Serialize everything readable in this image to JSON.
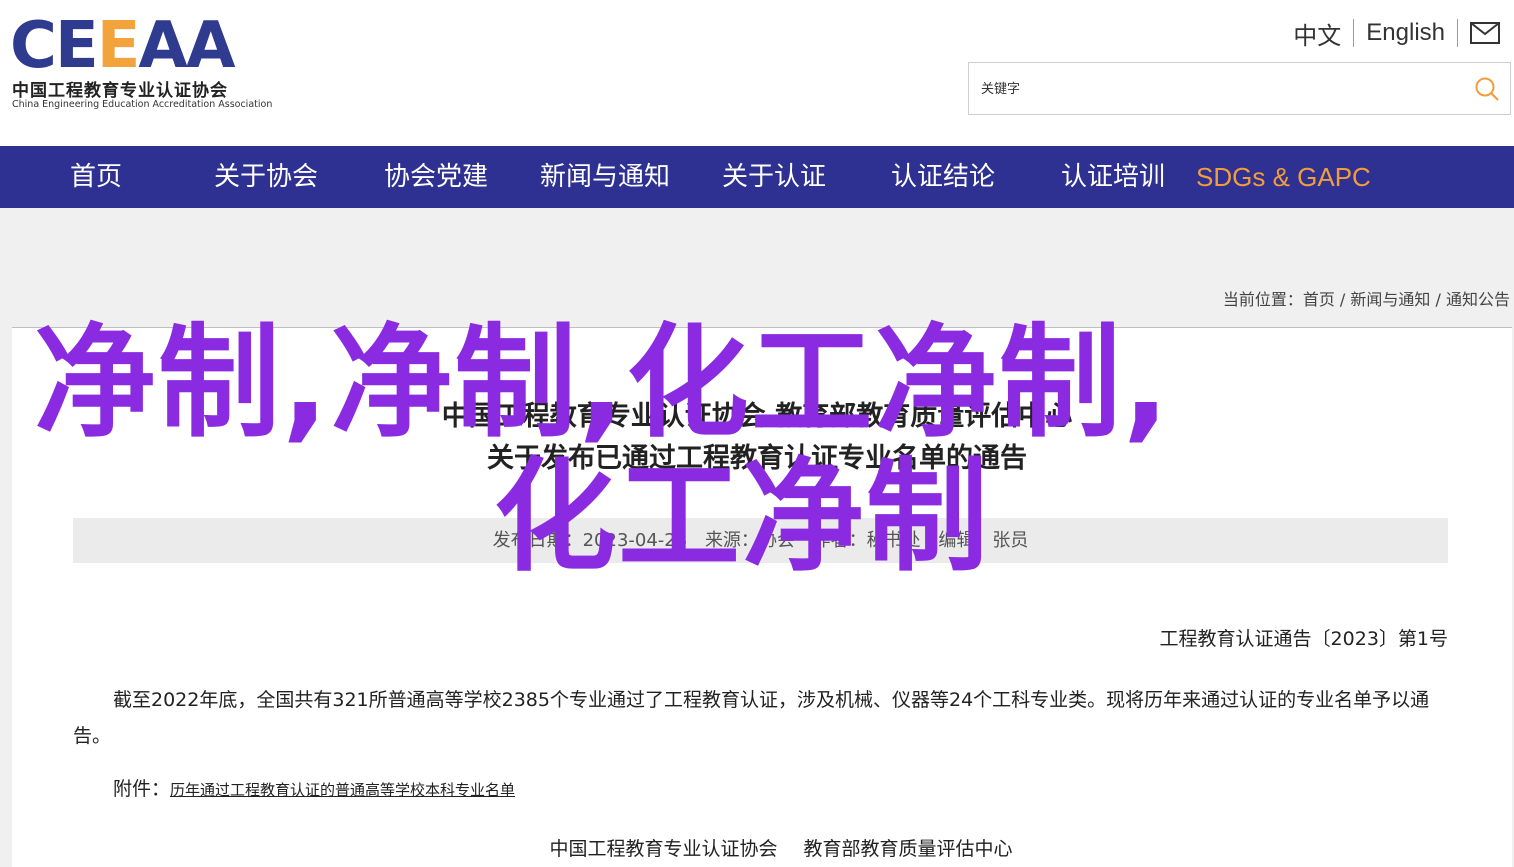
{
  "header": {
    "logo_mark": "CE",
    "logo_mark_mid": "E",
    "logo_mark_end": "AA",
    "logo_cn": "中国工程教育专业认证协会",
    "logo_en": "China Engineering Education Accreditation Association",
    "lang_cn": "中文",
    "lang_en": "English",
    "mail_icon": "mail-icon",
    "search_placeholder": "关键字",
    "search_icon": "search-icon"
  },
  "nav": {
    "items": [
      {
        "label": "首页"
      },
      {
        "label": "关于协会"
      },
      {
        "label": "协会党建"
      },
      {
        "label": "新闻与通知"
      },
      {
        "label": "关于认证"
      },
      {
        "label": "认证结论"
      },
      {
        "label": "认证培训"
      },
      {
        "label": "SDGs & GAPC"
      }
    ],
    "bg_color": "#2e3192",
    "accent_color": "#f39c3c"
  },
  "breadcrumb": {
    "prefix": "当前位置：",
    "items": [
      "首页",
      "新闻与通知",
      "通知公告"
    ],
    "sep": " / "
  },
  "article": {
    "title_line1": "中国工程教育专业认证协会 教育部教育质量评估中心",
    "title_line2": "关于发布已通过工程教育认证专业名单的通告",
    "meta_date": "发布日期：2023-04-28",
    "meta_source": "来源：协会",
    "meta_author": "作者：秘书处",
    "meta_editor": "编辑：张员",
    "doc_no": "工程教育认证通告〔2023〕第1号",
    "paragraph": "截至2022年底，全国共有321所普通高等学校2385个专业通过了工程教育认证，涉及机械、仪器等24个工科专业类。现将历年来通过认证的专业名单予以通告。",
    "attach_label": "附件：",
    "attach_link": "历年通过工程教育认证的普通高等学校本科专业名单",
    "sign_org1": "中国工程教育专业认证协会",
    "sign_org2": "教育部教育质量评估中心"
  },
  "overlay": {
    "line1": "净制,净制,化工净制,",
    "line2": "化工净制",
    "color": "#8a2be2"
  }
}
